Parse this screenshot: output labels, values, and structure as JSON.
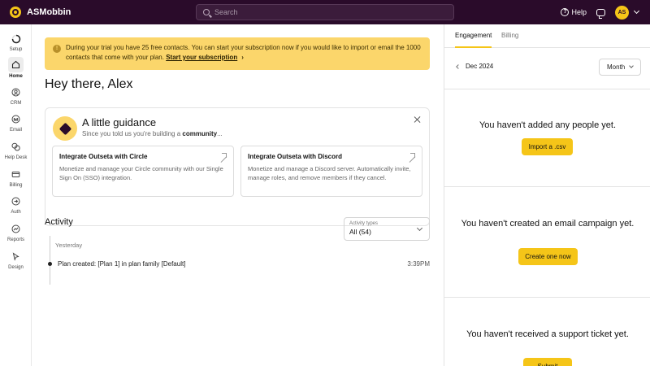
{
  "topbar": {
    "app_name": "ASMobbin",
    "search_placeholder": "Search",
    "help_label": "Help",
    "avatar_initials": "AS"
  },
  "nav": {
    "items": [
      {
        "label": "Setup",
        "icon": "setup-progress-icon"
      },
      {
        "label": "Home",
        "icon": "home-icon",
        "active": true
      },
      {
        "label": "CRM",
        "icon": "person-icon"
      },
      {
        "label": "Email",
        "icon": "email-icon"
      },
      {
        "label": "Help Desk",
        "icon": "chat-bubbles-icon"
      },
      {
        "label": "Billing",
        "icon": "billing-icon"
      },
      {
        "label": "Auth",
        "icon": "auth-arrow-icon"
      },
      {
        "label": "Reports",
        "icon": "reports-icon"
      },
      {
        "label": "Design",
        "icon": "cursor-icon"
      }
    ]
  },
  "trial_banner": {
    "text": "During your trial you have 25 free contacts. You can start your subscription now if you would like to import or email the 1000 contacts that come with your plan.",
    "link": "Start your subscription"
  },
  "greeting": "Hey there, Alex",
  "guidance": {
    "title": "A little guidance",
    "subtitle_prefix": "Since you told us you're building a",
    "subtitle_bold": "community",
    "subtitle_suffix": "...",
    "cards": [
      {
        "title": "Integrate Outseta with Circle",
        "desc": "Monetize and manage your Circle community with our Single Sign On (SSO) integration."
      },
      {
        "title": "Integrate Outseta with Discord",
        "desc": "Monetize and manage a Discord server. Automatically invite, manage roles, and remove members if they cancel."
      }
    ]
  },
  "activity": {
    "title": "Activity",
    "filter_label": "Activity types",
    "filter_value": "All (54)",
    "day": "Yesterday",
    "entries": [
      {
        "text": "Plan created: [Plan 1] in plan family [Default]",
        "time": "3:39PM"
      }
    ]
  },
  "right_panel": {
    "tabs": [
      "Engagement",
      "Billing"
    ],
    "active_tab": "Engagement",
    "period": "Dec 2024",
    "range": "Month",
    "sections": [
      {
        "text": "You haven't added any people yet.",
        "button": "Import a .csv"
      },
      {
        "text": "You haven't created an email campaign yet.",
        "button": "Create one now"
      },
      {
        "text": "You haven't received a support ticket yet.",
        "button": "Submit"
      }
    ]
  },
  "colors": {
    "topbar_bg": "#2a0b2a",
    "accent_yellow": "#f5c518",
    "banner_yellow": "#fbd66b"
  }
}
